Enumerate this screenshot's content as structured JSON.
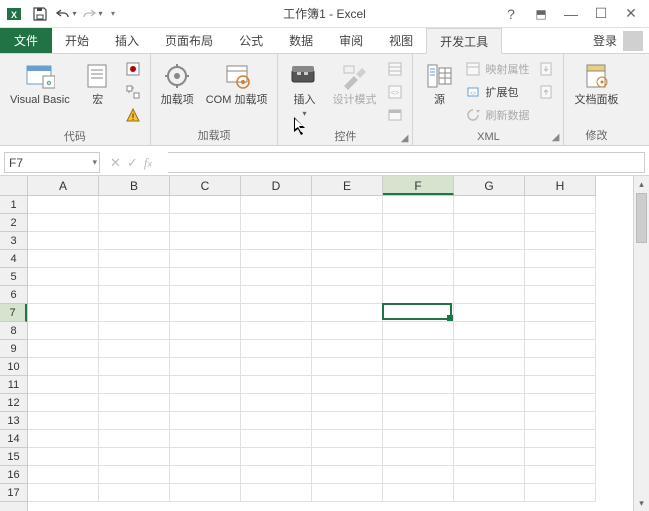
{
  "title": "工作簿1 - Excel",
  "tabs": {
    "file": "文件",
    "list": [
      "开始",
      "插入",
      "页面布局",
      "公式",
      "数据",
      "审阅",
      "视图",
      "开发工具"
    ],
    "active_index": 7,
    "login": "登录"
  },
  "ribbon": {
    "groups": {
      "code": {
        "label": "代码",
        "visual_basic": "Visual Basic",
        "macro": "宏"
      },
      "addins": {
        "label": "加载项",
        "addins": "加载项",
        "com_addins": "COM 加载项"
      },
      "controls": {
        "label": "控件",
        "insert": "插入",
        "design_mode": "设计模式"
      },
      "xml": {
        "label": "XML",
        "source": "源",
        "map_props": "映射属性",
        "expand_pack": "扩展包",
        "refresh": "刷新数据"
      },
      "modify": {
        "label": "修改",
        "doc_panel": "文档面板"
      }
    }
  },
  "fbar": {
    "namebox": "F7",
    "formula": ""
  },
  "grid": {
    "cols": [
      "A",
      "B",
      "C",
      "D",
      "E",
      "F",
      "G",
      "H"
    ],
    "rows": [
      "1",
      "2",
      "3",
      "4",
      "5",
      "6",
      "7",
      "8",
      "9",
      "10",
      "11",
      "12",
      "13",
      "14",
      "15",
      "16",
      "17"
    ],
    "selected_col_index": 5,
    "selected_row_index": 6
  }
}
